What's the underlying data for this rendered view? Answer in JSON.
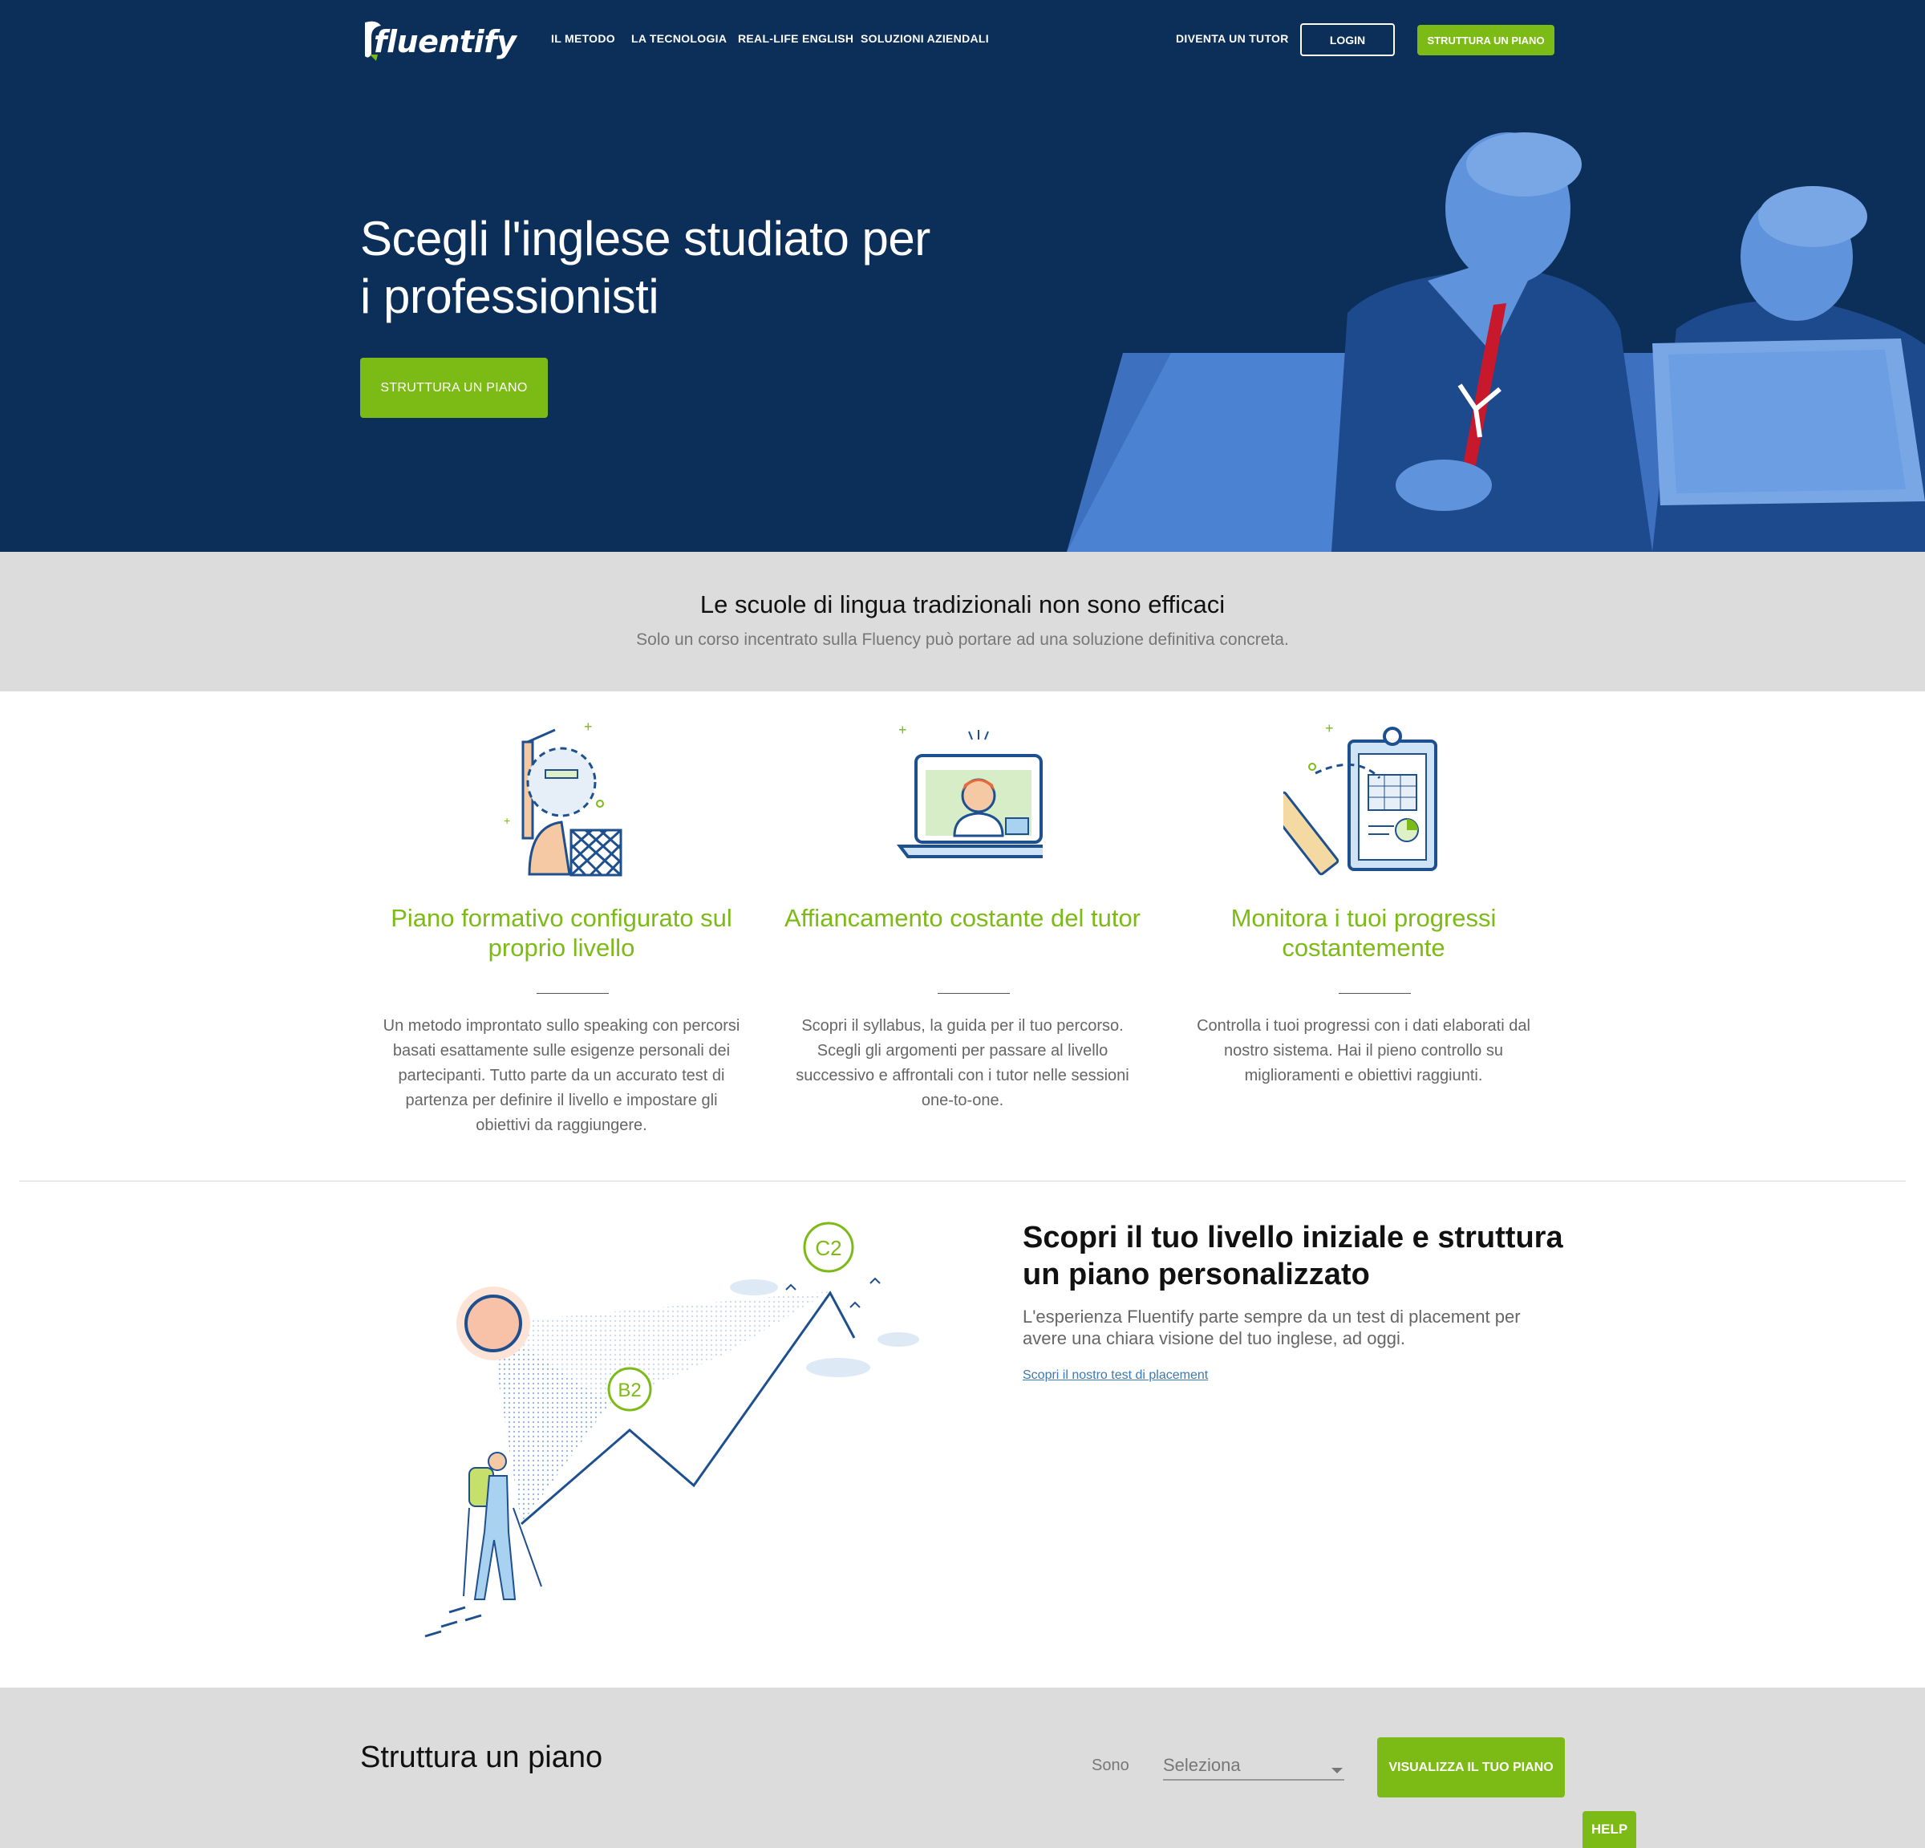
{
  "brand": {
    "logo_text": "fluentify"
  },
  "nav": {
    "links": [
      "IL METODO",
      "LA TECNOLOGIA",
      "REAL-LIFE ENGLISH",
      "SOLUZIONI AZIENDALI"
    ],
    "tutor_link": "DIVENTA UN TUTOR",
    "login_label": "LOGIN",
    "cta_label": "STRUTTURA UN PIANO"
  },
  "hero": {
    "title_line1": "Scegli l'inglese studiato per",
    "title_line2": "i professionisti",
    "cta_label": "STRUTTURA UN PIANO"
  },
  "intro": {
    "title": "Le scuole di lingua tradizionali non sono efficaci",
    "subtitle": "Solo un corso incentrato sulla Fluency può portare ad una soluzione definitiva concreta."
  },
  "features": [
    {
      "title": "Piano formativo configurato sul proprio livello",
      "text": "Un metodo improntato sullo speaking con percorsi basati esattamente sulle esigenze personali dei partecipanti. Tutto parte da un accurato test di partenza per definire il livello e impostare gli obiettivi da raggiungere."
    },
    {
      "title": "Affiancamento costante del tutor",
      "text": "Scopri il syllabus, la guida per il tuo percorso. Scegli gli argomenti per passare al livello successivo e affrontali con i tutor nelle sessioni one-to-one."
    },
    {
      "title": "Monitora i tuoi progressi costantemente",
      "text": "Controlla i tuoi progressi con i dati elaborati dal nostro sistema. Hai il pieno controllo su miglioramenti e obiettivi raggiunti."
    }
  ],
  "level": {
    "badge_start": "B2",
    "badge_goal": "C2",
    "title": "Scopri il tuo livello iniziale e struttura un piano personalizzato",
    "text": "L'esperienza Fluentify parte sempre da un test di placement per avere una chiara visione del tuo inglese, ad oggi.",
    "link": "Scopri il nostro test di placement"
  },
  "plan": {
    "title": "Struttura un piano",
    "sono_label": "Sono",
    "select_value": "Seleziona",
    "button_label": "VISUALIZZA IL TUO PIANO"
  },
  "help": {
    "label": "HELP"
  },
  "colors": {
    "navy": "#0c2f5a",
    "green": "#7cbb15",
    "grey_band": "#dcdcdc",
    "link": "#3c78b4"
  }
}
